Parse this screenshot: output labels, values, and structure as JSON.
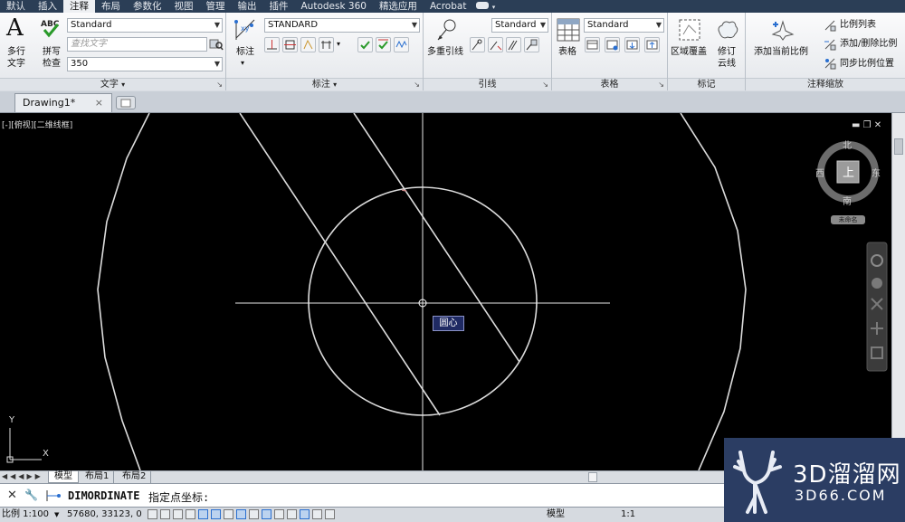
{
  "menu_tabs": [
    "默认",
    "插入",
    "注释",
    "布局",
    "参数化",
    "视图",
    "管理",
    "输出",
    "插件",
    "Autodesk 360",
    "精选应用",
    "Acrobat"
  ],
  "text_panel": {
    "multiline_label_1": "多行",
    "multiline_label_2": "文字",
    "spell_label_1": "拼写",
    "spell_label_2": "检查",
    "style_value": "Standard",
    "find_placeholder": "查找文字",
    "height_value": "350",
    "title": "文字"
  },
  "dim_panel": {
    "dim_label": "标注",
    "style_value": "STANDARD",
    "title": "标注"
  },
  "leader_panel": {
    "label": "多重引线",
    "style_value": "Standard",
    "title": "引线"
  },
  "table_panel": {
    "label": "表格",
    "style_value": "Standard",
    "title": "表格"
  },
  "markup_panel": {
    "wipeout_label": "区域覆盖",
    "revcloud_label_1": "修订",
    "revcloud_label_2": "云线",
    "title": "标记"
  },
  "scale_panel": {
    "add_current_label": "添加当前比例",
    "scale_list": "比例列表",
    "add_delete": "添加/删除比例",
    "sync": "同步比例位置",
    "title": "注释缩放"
  },
  "doc_tab": {
    "name": "Drawing1*",
    "close": "×"
  },
  "viewport_label": "[-][俯视][二维线框]",
  "viewcube": {
    "north": "北",
    "south": "南",
    "east": "东",
    "west": "西",
    "top": "上",
    "wcs": "未命名"
  },
  "tooltip": "圆心",
  "ucs": {
    "x": "X",
    "y": "Y"
  },
  "layout_tabs": [
    "模型",
    "布局1",
    "布局2"
  ],
  "command": {
    "name": "DIMORDINATE",
    "prompt": "指定点坐标:"
  },
  "status": {
    "scale": "比例 1:100",
    "coords": "57680, 33123, 0",
    "model": "模型",
    "annot_scale": "1:1"
  },
  "watermark": {
    "line1": "3D溜溜网",
    "line2": "3D66.COM"
  },
  "colors": {
    "menubar": "#2b3e56",
    "canvas": "#000000",
    "geometry": "#dcdcdc",
    "tooltip_bg": "#1f2a63",
    "watermark_bg": "#2b3d63"
  }
}
